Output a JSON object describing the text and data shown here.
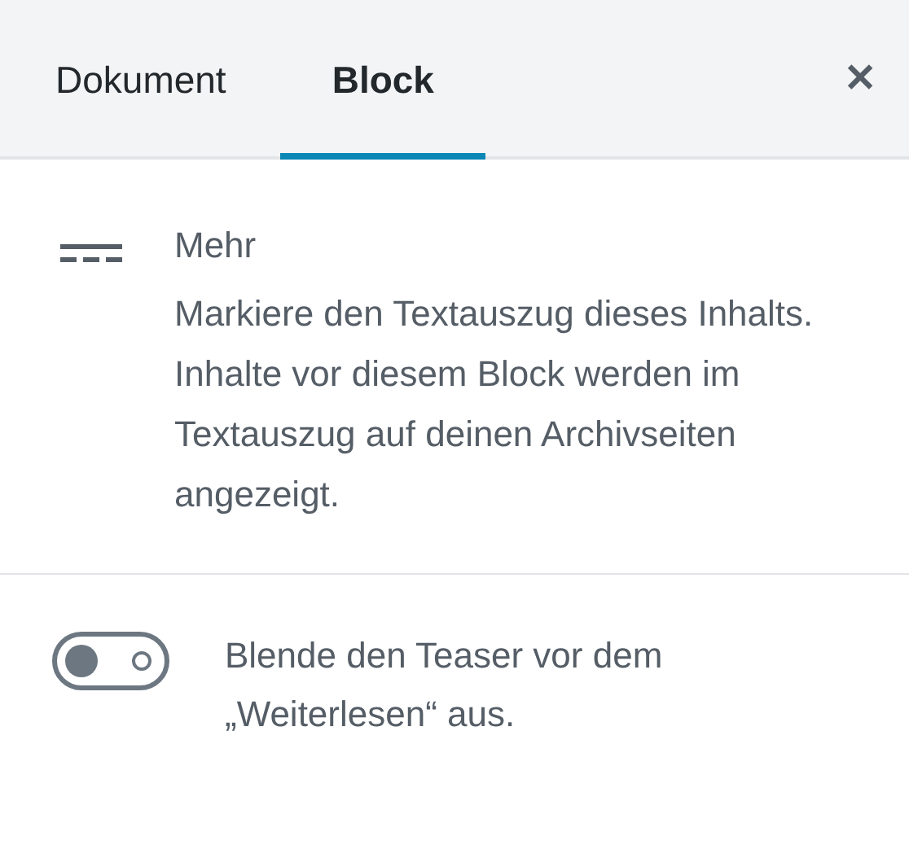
{
  "tabs": [
    {
      "label": "Dokument",
      "selected": false
    },
    {
      "label": "Block",
      "selected": true
    }
  ],
  "close": "✕",
  "block": {
    "title": "Mehr",
    "description": "Markiere den Textauszug dieses Inhalts. Inhalte vor diesem Block werden im Textauszug auf deinen Archivseiten angezeigt."
  },
  "setting": {
    "label": "Blende den Teaser vor dem „Weiterlesen“ aus.",
    "on": false
  }
}
